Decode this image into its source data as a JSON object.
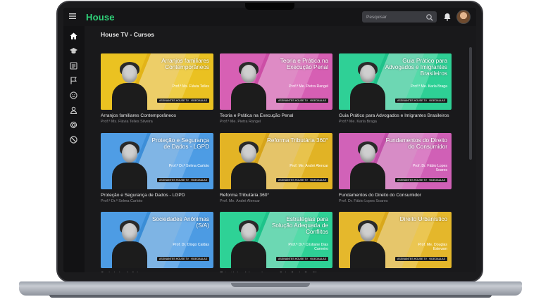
{
  "app": {
    "logo": "House"
  },
  "topbar": {
    "search_placeholder": "Pesquisar"
  },
  "page": {
    "title": "House TV - Cursos"
  },
  "sidebar": {
    "items": [
      {
        "icon": "home-icon"
      },
      {
        "icon": "graduation-cap-icon"
      },
      {
        "icon": "newspaper-icon"
      },
      {
        "icon": "flag-icon"
      },
      {
        "icon": "smiley-icon"
      },
      {
        "icon": "user-icon"
      },
      {
        "icon": "at-sign-icon"
      },
      {
        "icon": "block-icon"
      }
    ]
  },
  "courses": [
    {
      "thumb_title": "Arranjos familiares Contemporâneos",
      "thumb_prof": "Prof.ª Ms. Flávia Telles",
      "tag1": "ASSINANTES HOUSE TV",
      "tag2": "VIDEOAULAS",
      "caption": "Arranjos familiares Contemporâneos",
      "teacher": "Prof.ª Ms. Flávia Telles Silveira",
      "bg": "#e3b418",
      "accent": "#f2cd2a",
      "layout": "left"
    },
    {
      "thumb_title": "Teoria e Prática na Execução Penal",
      "thumb_prof": "Prof.ª Me. Pietra Rangel",
      "tag1": "ASSINANTES HOUSE TV",
      "tag2": "VIDEOAULAS",
      "caption": "Teoria e Prática na Execução Penal",
      "teacher": "Prof.ª Me. Pietra Rangel",
      "bg": "#cc4ea6",
      "accent": "#e070c0",
      "layout": "left"
    },
    {
      "thumb_title": "Guia Prático para Advogados e Imigrantes Brasileiros",
      "thumb_prof": "Prof.ª Me. Karla Braga",
      "tag1": "ASSINANTES HOUSE TV",
      "tag2": "VIDEOAULAS",
      "caption": "Guia Prático para Advogados e Imigrantes Brasileiros",
      "teacher": "Prof.ª Me. Karla Braga",
      "bg": "#1fc28a",
      "accent": "#3ddda0",
      "layout": "left"
    },
    {
      "thumb_title": "Proteção e Segurança de Dados - LGPD",
      "thumb_prof": "Prof.ª Dr.ª Selma Carloto",
      "tag1": "ASSINANTES HOUSE TV",
      "tag2": "VIDEOAULAS",
      "caption": "Proteção e Segurança de Dados - LGPD",
      "teacher": "Prof.ª Dr.ª Selma Carloto",
      "bg": "#3d8ed8",
      "accent": "#5eaaf0",
      "layout": "left"
    },
    {
      "thumb_title": "Reforma Tributária 360°",
      "thumb_prof": "Prof. Me. André Alencar",
      "tag1": "ASSINANTES HOUSE TV",
      "tag2": "VIDEOAULAS",
      "caption": "Reforma Tributária 360°",
      "teacher": "Prof. Me. André Alencar",
      "bg": "#d7a51a",
      "accent": "#ecc130",
      "layout": "left"
    },
    {
      "thumb_title": "Fundamentos do Direito do Consumidor",
      "thumb_prof": "Prof. Dr. Fábio Lopes Soares",
      "tag1": "ASSINANTES HOUSE TV",
      "tag2": "VIDEOAULAS",
      "caption": "Fundamentos do Direito do Consumidor",
      "teacher": "Prof. Dr. Fábio Lopes Soares",
      "bg": "#c24fa8",
      "accent": "#de72c4",
      "layout": "left"
    },
    {
      "thumb_title": "Sociedades Anônimas (S/A)",
      "thumb_prof": "Prof. Dr. Diogo Caldas",
      "tag1": "ASSINANTES HOUSE TV",
      "tag2": "VIDEOAULAS",
      "caption": "Sociedades Anônimas",
      "teacher": "",
      "bg": "#3a8dd6",
      "accent": "#5daaf0",
      "layout": "left"
    },
    {
      "thumb_title": "Estratégias para Solução Adequada de Conflitos",
      "thumb_prof": "Prof.ª Dr.ª Cristiane Dias Carneiro",
      "tag1": "ASSINANTES HOUSE TV",
      "tag2": "VIDEOAULAS",
      "caption": "Estratégias Adequadas para Solução de Conflitos",
      "teacher": "",
      "bg": "#1ec38a",
      "accent": "#3ddea0",
      "layout": "left"
    },
    {
      "thumb_title": "Direito Urbanístico",
      "thumb_prof": "Prof. Me. Douglas Estevam",
      "tag1": "ASSINANTES HOUSE TV",
      "tag2": "VIDEOAULAS",
      "caption": "",
      "teacher": "",
      "bg": "#d9a81c",
      "accent": "#efc53a",
      "layout": "left"
    }
  ]
}
